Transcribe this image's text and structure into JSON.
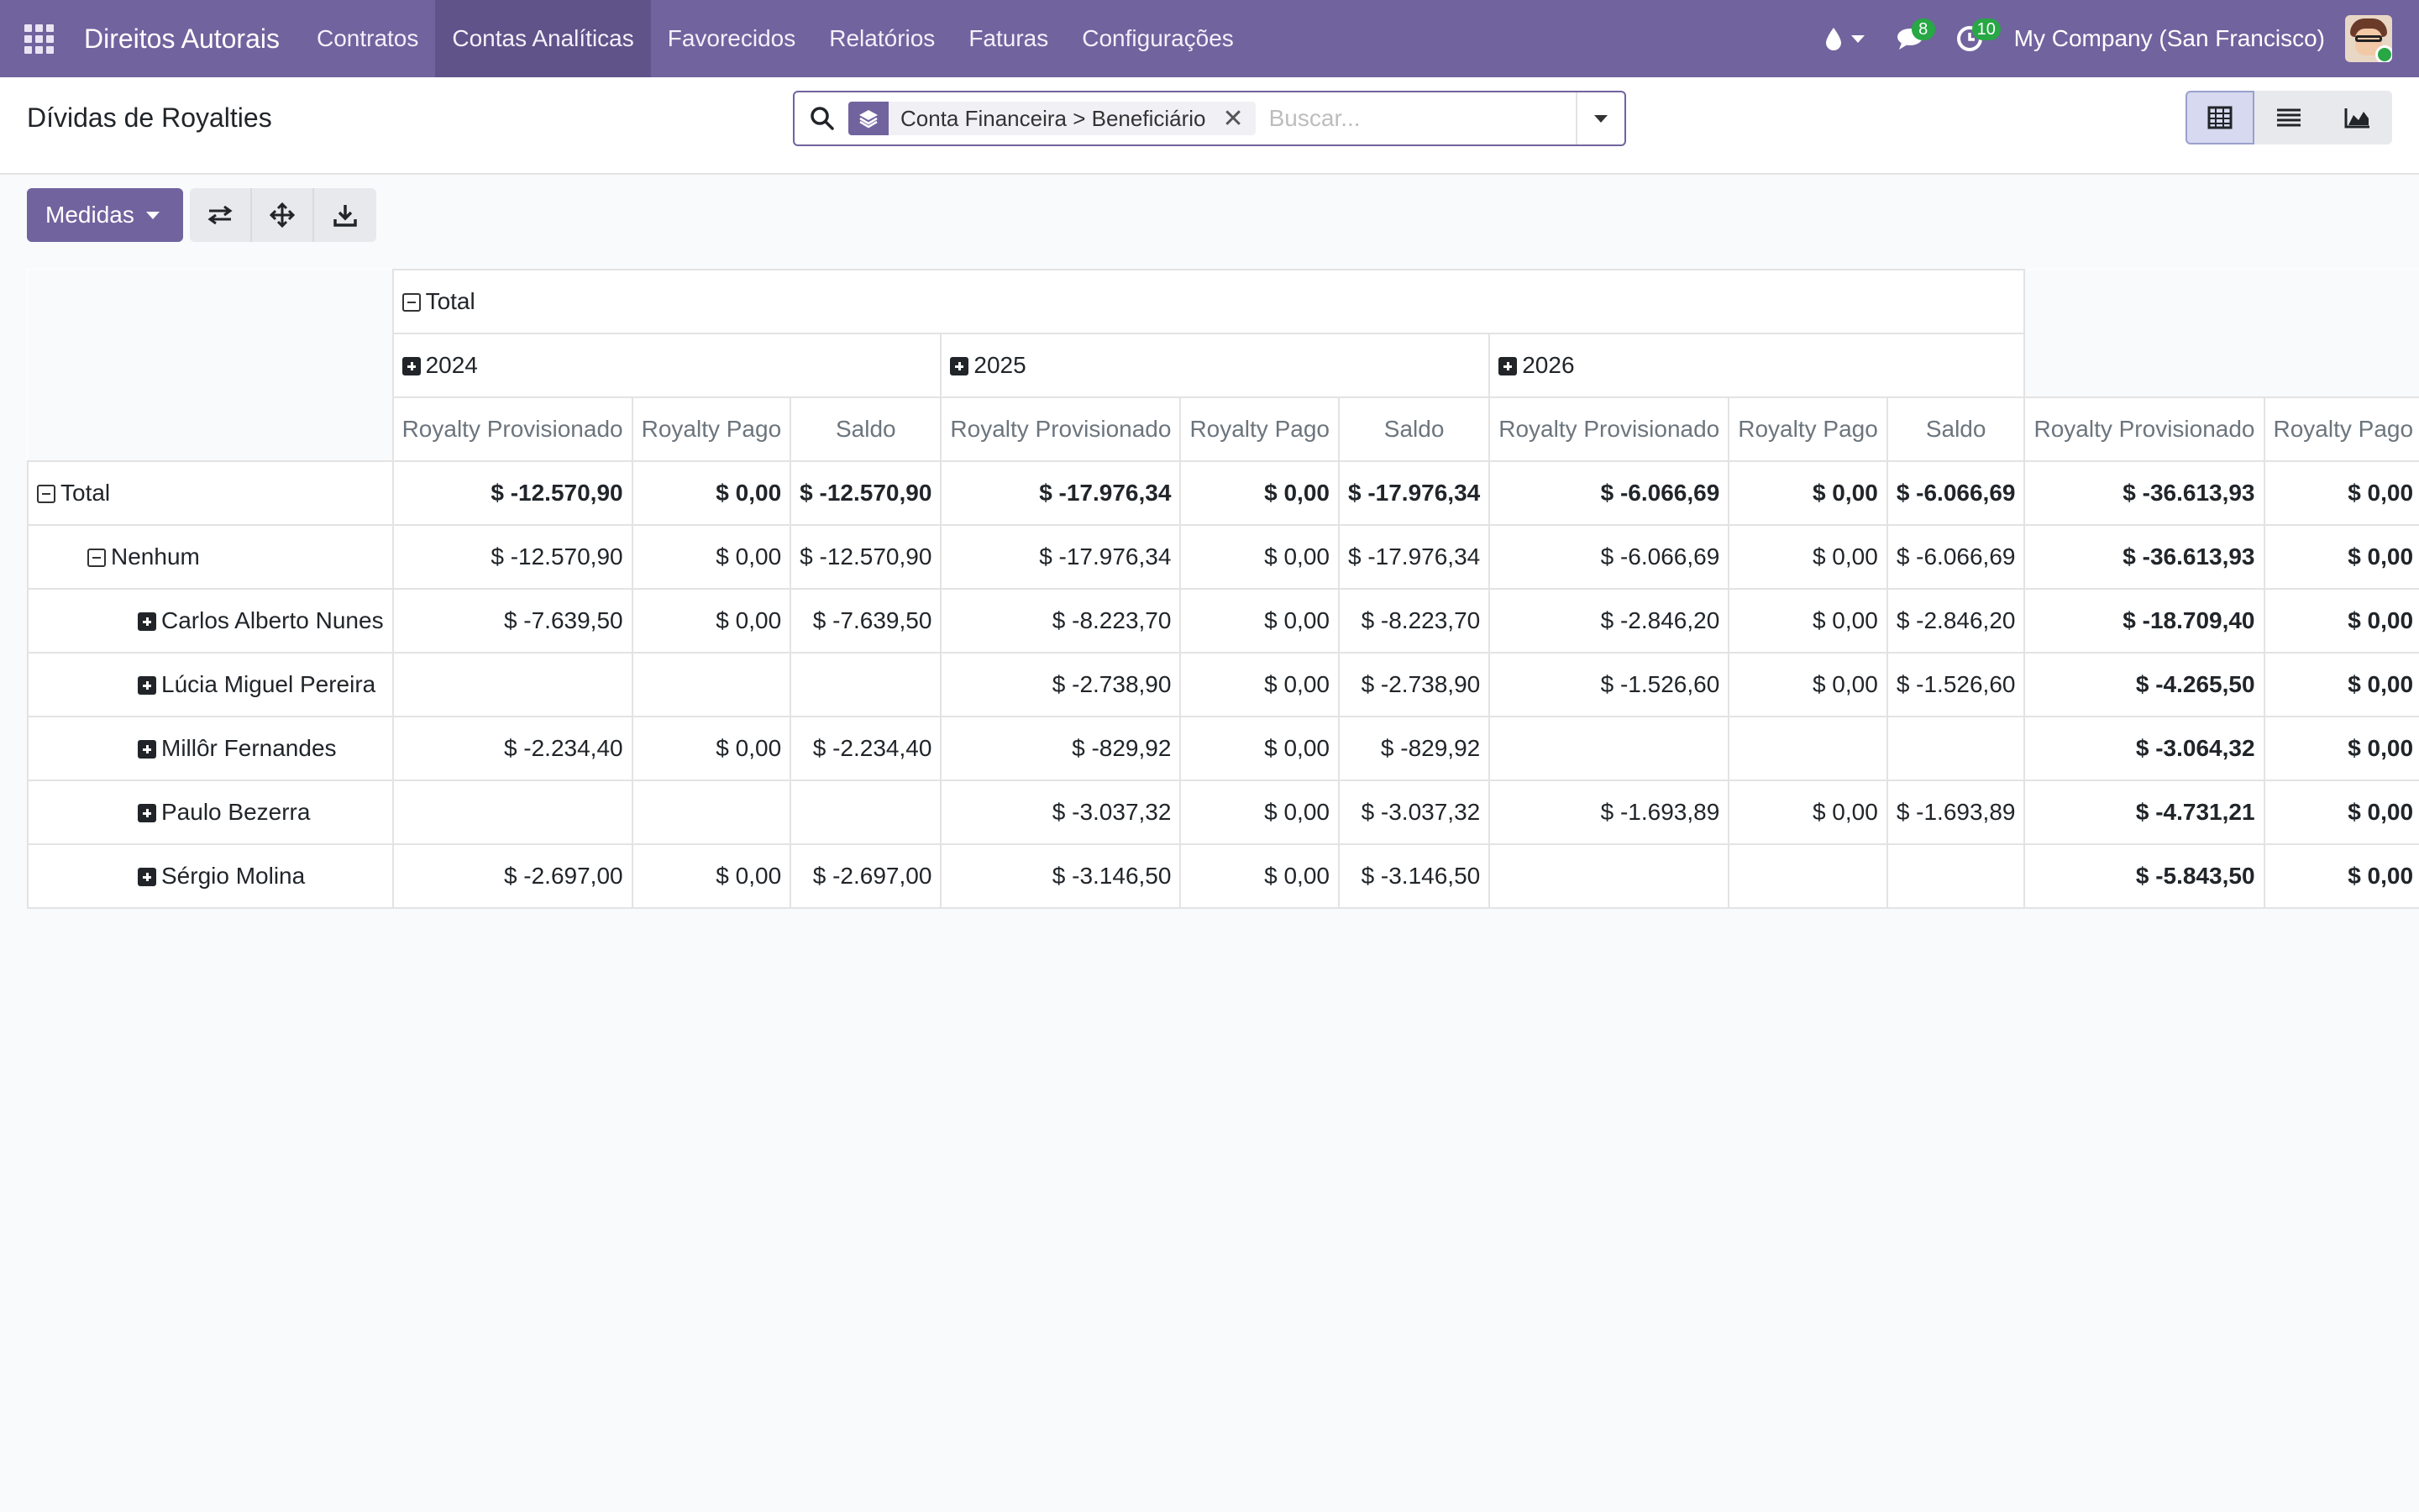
{
  "navbar": {
    "brand": "Direitos Autorais",
    "items": [
      {
        "label": "Contratos",
        "active": false
      },
      {
        "label": "Contas Analíticas",
        "active": true
      },
      {
        "label": "Favorecidos",
        "active": false
      },
      {
        "label": "Relatórios",
        "active": false
      },
      {
        "label": "Faturas",
        "active": false
      },
      {
        "label": "Configurações",
        "active": false
      }
    ],
    "messages_count": "8",
    "activities_count": "10",
    "company": "My Company (San Francisco)"
  },
  "control": {
    "title": "Dívidas de Royalties",
    "facet_label": "Conta Financeira > Beneficiário",
    "search_placeholder": "Buscar..."
  },
  "toolbar": {
    "measures_label": "Medidas"
  },
  "pivot": {
    "total_header": "Total",
    "years": [
      "2024",
      "2025",
      "2026"
    ],
    "measures": [
      "Royalty Provisionado",
      "Royalty Pago",
      "Saldo"
    ],
    "total_columns_visible": [
      "Royalty Provisionado",
      "Royalty Pago"
    ],
    "rows": [
      {
        "label": "Total",
        "level": 0,
        "icon": "minus",
        "bold": true,
        "cells": [
          "$ -12.570,90",
          "$ 0,00",
          "$ -12.570,90",
          "$ -17.976,34",
          "$ 0,00",
          "$ -17.976,34",
          "$ -6.066,69",
          "$ 0,00",
          "$ -6.066,69",
          "$ -36.613,93",
          "$ 0,00"
        ]
      },
      {
        "label": "Nenhum",
        "level": 1,
        "icon": "minus",
        "bold": false,
        "cells": [
          "$ -12.570,90",
          "$ 0,00",
          "$ -12.570,90",
          "$ -17.976,34",
          "$ 0,00",
          "$ -17.976,34",
          "$ -6.066,69",
          "$ 0,00",
          "$ -6.066,69",
          "$ -36.613,93",
          "$ 0,00"
        ]
      },
      {
        "label": "Carlos Alberto Nunes",
        "level": 2,
        "icon": "plus",
        "bold": false,
        "cells": [
          "$ -7.639,50",
          "$ 0,00",
          "$ -7.639,50",
          "$ -8.223,70",
          "$ 0,00",
          "$ -8.223,70",
          "$ -2.846,20",
          "$ 0,00",
          "$ -2.846,20",
          "$ -18.709,40",
          "$ 0,00"
        ]
      },
      {
        "label": "Lúcia Miguel Pereira",
        "level": 2,
        "icon": "plus",
        "bold": false,
        "cells": [
          "",
          "",
          "",
          "$ -2.738,90",
          "$ 0,00",
          "$ -2.738,90",
          "$ -1.526,60",
          "$ 0,00",
          "$ -1.526,60",
          "$ -4.265,50",
          "$ 0,00"
        ]
      },
      {
        "label": "Millôr Fernandes",
        "level": 2,
        "icon": "plus",
        "bold": false,
        "cells": [
          "$ -2.234,40",
          "$ 0,00",
          "$ -2.234,40",
          "$ -829,92",
          "$ 0,00",
          "$ -829,92",
          "",
          "",
          "",
          "$ -3.064,32",
          "$ 0,00"
        ]
      },
      {
        "label": "Paulo Bezerra",
        "level": 2,
        "icon": "plus",
        "bold": false,
        "cells": [
          "",
          "",
          "",
          "$ -3.037,32",
          "$ 0,00",
          "$ -3.037,32",
          "$ -1.693,89",
          "$ 0,00",
          "$ -1.693,89",
          "$ -4.731,21",
          "$ 0,00"
        ]
      },
      {
        "label": "Sérgio Molina",
        "level": 2,
        "icon": "plus",
        "bold": false,
        "cells": [
          "$ -2.697,00",
          "$ 0,00",
          "$ -2.697,00",
          "$ -3.146,50",
          "$ 0,00",
          "$ -3.146,50",
          "",
          "",
          "",
          "$ -5.843,50",
          "$ 0,00"
        ]
      }
    ]
  },
  "colors": {
    "brand": "#71639e",
    "brand_dark": "#5f5389",
    "badge": "#28a745"
  }
}
